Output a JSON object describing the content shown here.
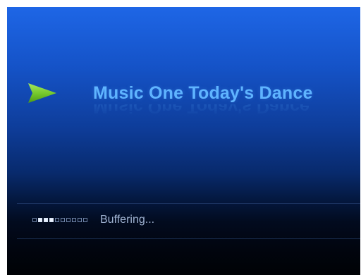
{
  "player": {
    "title": "Music One Today's Dance",
    "status": "Buffering...",
    "play_icon": "play-icon",
    "buffer_progress": {
      "total": 10,
      "active": [
        1,
        2,
        3
      ]
    }
  },
  "colors": {
    "title": "#5fb4ff",
    "play_icon": "#7ccf2e",
    "status_text": "#9fb2d1",
    "background_top": "#1e66e6",
    "background_bottom": "#000205"
  }
}
